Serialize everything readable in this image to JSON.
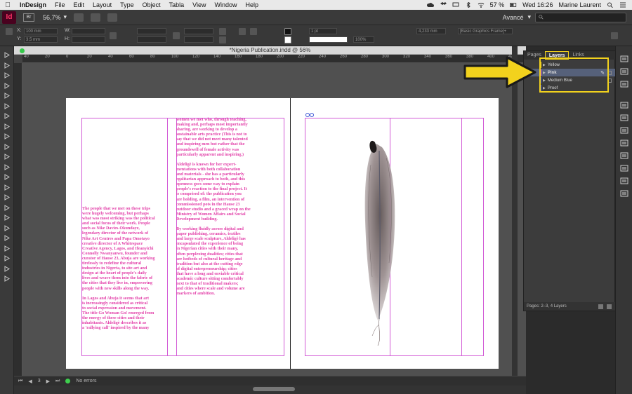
{
  "menubar": {
    "app_name": "InDesign",
    "items": [
      "File",
      "Edit",
      "Layout",
      "Type",
      "Object",
      "Tabla",
      "View",
      "Window",
      "Help"
    ],
    "battery": "57 %",
    "clock": "Wed 16:26",
    "user": "Marine Laurent"
  },
  "appbar": {
    "logo": "Id",
    "bridge": "Br",
    "zoom": "56,7%",
    "workspace": "Avancé"
  },
  "controlbar": {
    "x_label": "X:",
    "x_value": "100 mm",
    "y_label": "Y:",
    "y_value": "3,5 mm",
    "w_label": "W:",
    "h_label": "H:",
    "stroke_weight": "1 pt",
    "percent": "100%",
    "width_value": "4,233 mm",
    "style_value": "[Basic Graphics Frame]+"
  },
  "document": {
    "title": "*Nigeria Publication.indd @ 56%",
    "ruler_ticks": [
      "40",
      "20",
      "0",
      "20",
      "40",
      "60",
      "80",
      "100",
      "120",
      "140",
      "160",
      "180",
      "200",
      "220",
      "240",
      "260",
      "280",
      "300",
      "320",
      "340",
      "360",
      "380",
      "400",
      "420"
    ],
    "left_col1_text": "The people that we met on these trips\nwere hugely welcoming, but perhaps\nwhat was most striking was the political\nand social focus of their work. People\nsuch as Nike Davies-Okundaye,\nlegendary director of the network of\nNike Art Centres and Papa Omotayo\ncreative director of A Whitespace\nCreative Agency, Lagos, and Ifeanyichi\nConnolly Nwanyanwu, founder and\ncurator of Hause 23, Abuja are working\ntirelessly to redefine the cultural\nindustries in Nigeria, to site art and\ndesign at the heart of people's daily\nlives and weave them into the fabric of\nthe cities that they live in, empowering\npeople with new skills along the way.\n\nIn Lagos and Abuja it seems that art\nis increasingly considered as critical\nto social expression and movement.\nThe title Go Woman Go! emerged from\nthe energy of these cities and their\ninhabitants. Aldeligè describes it as\na 'rallying call' inspired by the many",
    "left_col2_text": "women we met who, through teaching,\nmaking and, perhaps most importantly\nsharing, are working to develop a\nsustainable arts practice (This is not to\nsay that we did not meet many talented\nand inspiring men but rather that the\ngroundswell of female activity was\nparticularly apparent and inspiring.)\n\nAldeligè is known for her expert-\nmentations with both collaboration\nand materials - she has a particularly\negalitarian approach to both, and this\nopenness goes some way to explain\npeople's reaction to the final project. It\nis comprised of: the publication you\nare holding, a film, an intervention of\ncommissioned pots in the Hause 23\noutdoor studio and a graced wrap on the\nMinistry of Women Affairs and Social\nDevelopment building.\n\nBy working fluidly across digital and\npaper publishing, ceramics, textiles\nand large scale sculpture, Aldeligè has\nencapsulated the experience of being\nin Nigerian cities with their many,\noften perplexing dualities; cities that\nare hotbeds of cultural heritage and\ntradition but also at the cutting edge\nof digital entrepreneurship; cities\nthat have a long and enviable critical\nacademic culture sitting comfortably\nnext to that of traditional makers;\nand cities where scale and volume are\nmarkers of ambition.",
    "page_number": "3",
    "status": "No errors"
  },
  "layers_panel": {
    "tabs": [
      "Pages",
      "Layers",
      "Links"
    ],
    "layers": [
      {
        "name": "Yellow",
        "color": "#f2d21d"
      },
      {
        "name": "Pink",
        "color": "#d25bd6"
      },
      {
        "name": "Medium Blue",
        "color": "#3a55d6"
      },
      {
        "name": "Proof",
        "color": "#4a5fe0"
      }
    ],
    "footer": "Pages: 2–3, 4 Layers"
  },
  "colors": {
    "accent_yellow": "#f2d21d",
    "text_pink": "#e23fa8",
    "frame_magenta": "#d25bd6"
  }
}
